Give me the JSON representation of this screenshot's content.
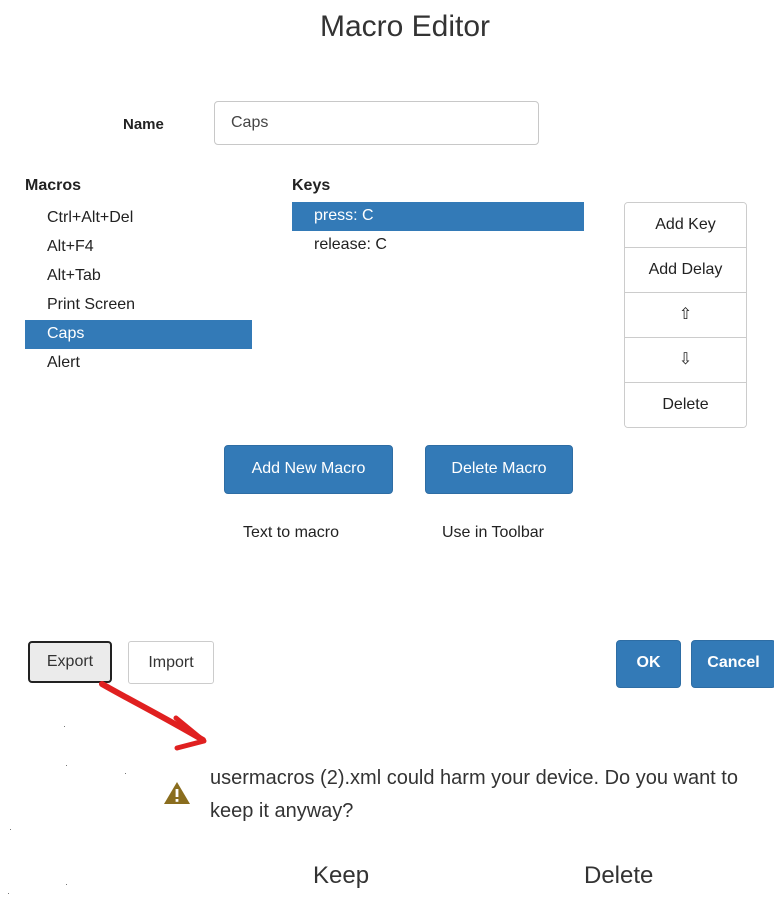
{
  "dialog": {
    "title": "Macro Editor"
  },
  "name": {
    "label": "Name",
    "value": "Caps"
  },
  "macros": {
    "header": "Macros",
    "items": [
      "Ctrl+Alt+Del",
      "Alt+F4",
      "Alt+Tab",
      "Print Screen",
      "Caps",
      "Alert"
    ],
    "selected": "Caps"
  },
  "keys": {
    "header": "Keys",
    "items": [
      "press: C",
      "release: C"
    ],
    "selected": "press: C"
  },
  "key_actions": {
    "add_key": "Add Key",
    "add_delay": "Add Delay",
    "move_up": "⇧",
    "move_down": "⇩",
    "delete": "Delete"
  },
  "macro_actions": {
    "add_new": "Add New Macro",
    "delete": "Delete Macro",
    "text_to_macro": "Text to macro",
    "use_in_toolbar": "Use in Toolbar"
  },
  "footer": {
    "export": "Export",
    "import": "Import",
    "ok": "OK",
    "cancel": "Cancel"
  },
  "download_warning": {
    "message": "usermacros (2).xml could harm your device. Do you want to keep it anyway?",
    "keep": "Keep",
    "delete": "Delete",
    "icon": "warning-icon"
  },
  "colors": {
    "accent": "#337ab7",
    "annotation_arrow": "#e02020",
    "warning_icon": "#8a6d1e"
  }
}
